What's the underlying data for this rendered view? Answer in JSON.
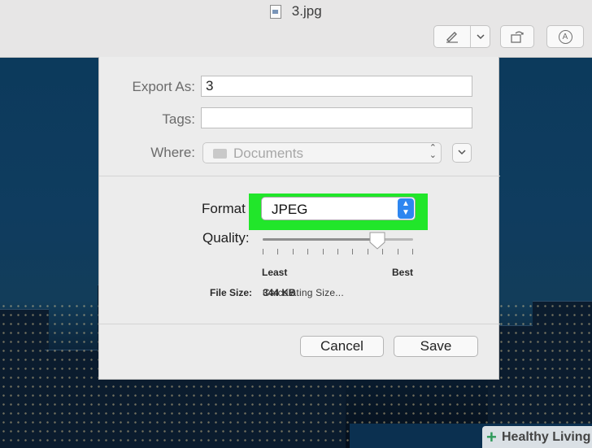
{
  "window": {
    "title": "3.jpg"
  },
  "toolbar": {
    "markup_icon": "pen-icon",
    "dropdown_icon": "chevron-down-icon",
    "rotate_icon": "rotate-icon",
    "annotate_icon": "markup-circle-icon"
  },
  "export_sheet": {
    "export_as_label": "Export As:",
    "export_as_value": "3",
    "tags_label": "Tags:",
    "tags_value": "",
    "where_label": "Where:",
    "where_value": "Documents",
    "format_label": "Format",
    "format_value": "JPEG",
    "quality_label": "Quality:",
    "quality_level": 0.76,
    "quality_min_label": "Least",
    "quality_max_label": "Best",
    "file_size_label": "File Size:",
    "file_size_value": "344 KB",
    "file_size_status": "Calculating Size...",
    "cancel_label": "Cancel",
    "save_label": "Save"
  },
  "highlight_color": "#21e62a",
  "accent_color": "#2e86f0",
  "watermark": {
    "text": "Healthy Living"
  }
}
